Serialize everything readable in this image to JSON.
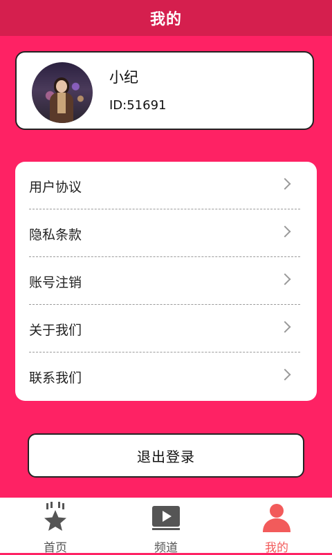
{
  "header": {
    "title": "我的"
  },
  "profile": {
    "nickname": "小纪",
    "id_text": "ID:51691"
  },
  "menu": [
    {
      "label": "用户协议"
    },
    {
      "label": "隐私条款"
    },
    {
      "label": "账号注销"
    },
    {
      "label": "关于我们"
    },
    {
      "label": "联系我们"
    }
  ],
  "logout": {
    "label": "退出登录"
  },
  "tabbar": {
    "tabs": [
      {
        "label": "首页",
        "icon": "star-icon"
      },
      {
        "label": "频道",
        "icon": "play-icon"
      },
      {
        "label": "我的",
        "icon": "person-icon",
        "active": true
      }
    ]
  },
  "colors": {
    "background": "#FE2264",
    "header": "#D51F4E",
    "active_tab": "#F25B5B",
    "inactive_tab": "#555555"
  }
}
